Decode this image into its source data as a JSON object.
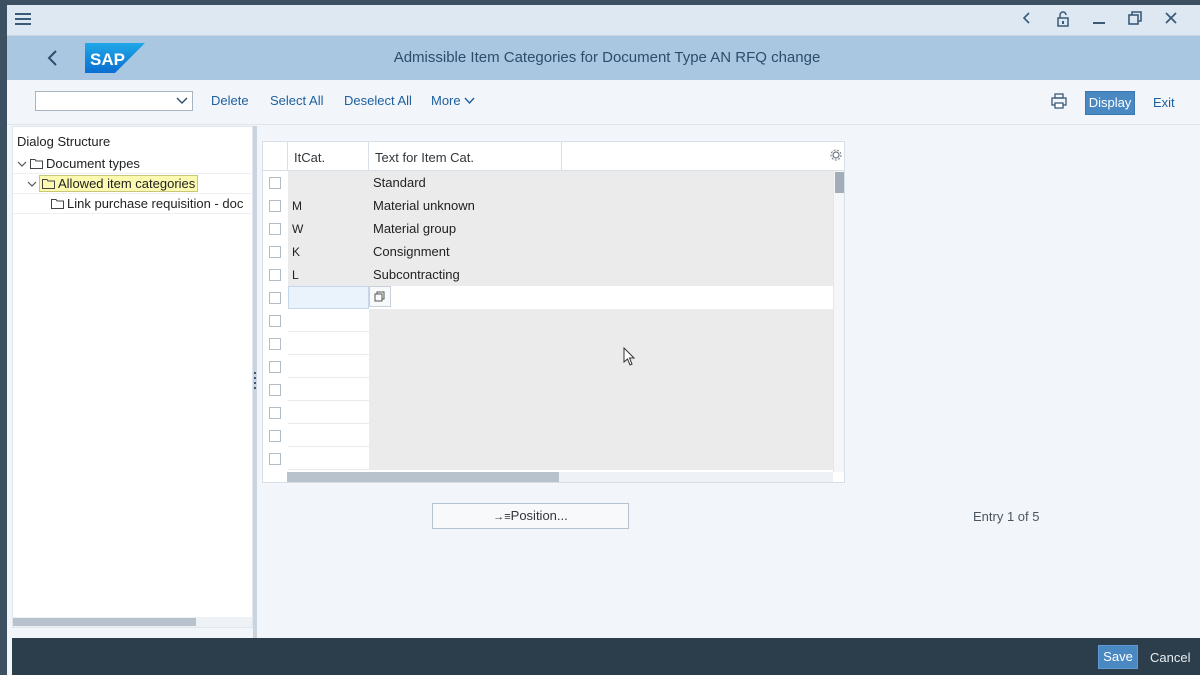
{
  "window": {
    "title": "Admissible Item Categories for Document Type AN RFQ change",
    "logo_text": "SAP"
  },
  "toolbar": {
    "dropdown_value": "",
    "delete_label": "Delete",
    "select_all_label": "Select All",
    "deselect_all_label": "Deselect All",
    "more_label": "More",
    "display_label": "Display",
    "exit_label": "Exit"
  },
  "dialog_structure": {
    "title": "Dialog Structure",
    "items": [
      {
        "label": "Document types",
        "level": 0
      },
      {
        "label": "Allowed item categories",
        "level": 1,
        "selected": true
      },
      {
        "label": "Link purchase requisition - doc",
        "level": 2
      }
    ]
  },
  "table": {
    "columns": [
      "ItCat.",
      "Text for Item Cat."
    ],
    "rows": [
      {
        "code": "",
        "text": "Standard"
      },
      {
        "code": "M",
        "text": "Material unknown"
      },
      {
        "code": "W",
        "text": "Material group"
      },
      {
        "code": "K",
        "text": "Consignment"
      },
      {
        "code": "L",
        "text": "Subcontracting"
      }
    ],
    "empty_rows": 8
  },
  "position_button": "Position...",
  "entry_info": "Entry 1 of 5",
  "footer": {
    "save_label": "Save",
    "cancel_label": "Cancel"
  },
  "colors": {
    "header_bg": "#a9c7e0",
    "accent": "#4a88c2",
    "footer_bg": "#2c3e4b"
  },
  "icons": [
    "hamburger-icon",
    "back-arrow-icon",
    "lock-icon",
    "minimize-icon",
    "restore-icon",
    "close-icon",
    "chevron-down-icon",
    "print-icon",
    "settings-icon",
    "folder-icon",
    "value-help-icon"
  ]
}
